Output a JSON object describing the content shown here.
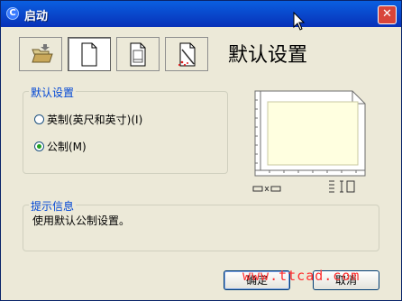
{
  "window": {
    "title": "启动",
    "close_glyph": "✕"
  },
  "toolbar": {
    "buttons": [
      {
        "id": "open-drawing",
        "icon": "folder-open-icon"
      },
      {
        "id": "start-from-scratch",
        "icon": "blank-page-icon",
        "selected": true
      },
      {
        "id": "use-template",
        "icon": "template-page-icon"
      },
      {
        "id": "use-wizard",
        "icon": "wizard-page-icon"
      }
    ]
  },
  "heading": "默认设置",
  "settings_group": {
    "label": "默认设置",
    "options": [
      {
        "label": "英制(英尺和英寸)(I)",
        "checked": false
      },
      {
        "label": "公制(M)",
        "checked": true
      }
    ]
  },
  "hint_group": {
    "label": "提示信息",
    "text": "使用默认公制设置。"
  },
  "buttons": {
    "ok": "确定",
    "cancel": "取消"
  },
  "watermark": "www.ttcad.com"
}
